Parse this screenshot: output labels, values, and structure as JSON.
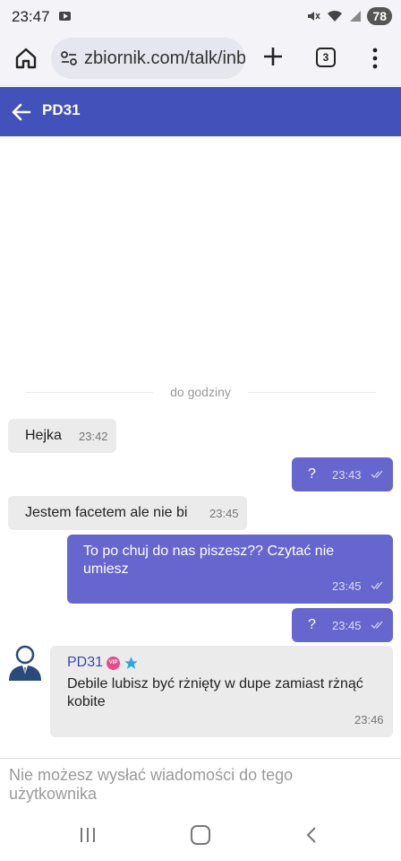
{
  "status_bar": {
    "time": "23:47",
    "battery": "78"
  },
  "browser": {
    "url": "zbiornik.com/talk/inbox",
    "tab_count": "3"
  },
  "conversation": {
    "title": "PD31",
    "divider_label": "do godziny",
    "messages": [
      {
        "direction": "in",
        "text": "Hejka",
        "time": "23:42"
      },
      {
        "direction": "out",
        "text": "?",
        "time": "23:43"
      },
      {
        "direction": "in",
        "text": "Jestem facetem ale nie bi",
        "time": "23:45"
      },
      {
        "direction": "out",
        "text": "To po chuj do nas piszesz?? Czytać nie umiesz",
        "time": "23:45"
      },
      {
        "direction": "out",
        "text": "?",
        "time": "23:45"
      },
      {
        "direction": "in",
        "sender": "PD31",
        "badge": "VIP",
        "text": "Debile lubisz być rżnięty w dupe zamiast rżnąć kobite",
        "time": "23:46"
      }
    ]
  },
  "footer": {
    "notice": "Nie możesz wysłać wiadomości do tego użytkownika"
  },
  "colors": {
    "header": "#4352ba",
    "outgoing_bubble": "#6766cf",
    "incoming_bubble": "#ebebeb"
  },
  "icons": [
    "home-icon",
    "site-settings-icon",
    "plus-icon",
    "tabs-icon",
    "menu-icon",
    "back-arrow-icon",
    "avatar-icon",
    "vip-badge-icon",
    "star-icon",
    "read-ticks-icon",
    "recent-apps-icon",
    "home-button-icon",
    "nav-back-icon"
  ]
}
